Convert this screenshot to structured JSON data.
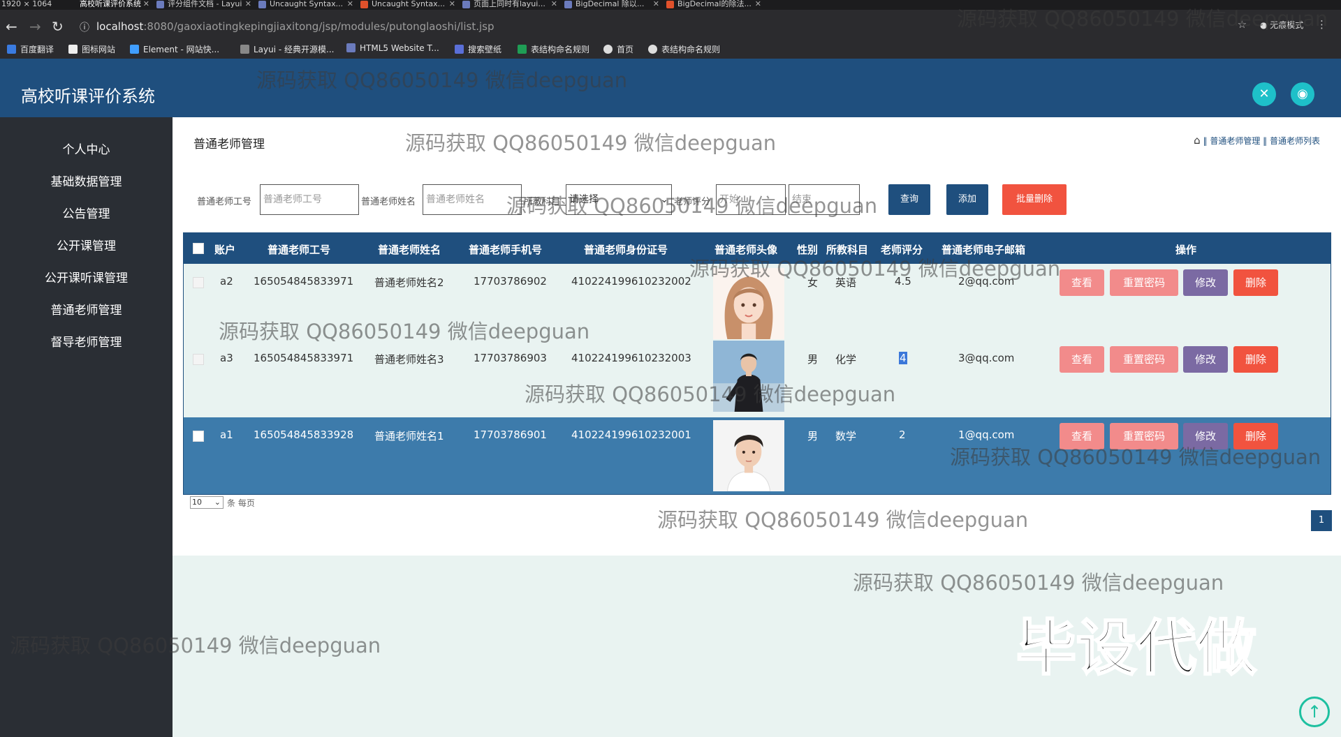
{
  "browser": {
    "tabs": [
      {
        "label": "1920 × 1064"
      },
      {
        "label": "高校听课评价系统"
      },
      {
        "label": "评分组件文档 - Layui"
      },
      {
        "label": "Uncaught Syntax..."
      },
      {
        "label": "Uncaught Syntax..."
      },
      {
        "label": "页面上同时有layui..."
      },
      {
        "label": "BigDecimal 除以..."
      },
      {
        "label": "BigDecimal的除法..."
      }
    ],
    "url_host": "localhost",
    "url_path": ":8080/gaoxiaotingkepingjiaxitong/jsp/modules/putonglaoshi/list.jsp",
    "incognito": "无痕模式",
    "bookmarks": [
      "百度翻译",
      "图标网站",
      "Element - 网站快...",
      "Layui - 经典开源模...",
      "HTML5 Website T...",
      "搜索壁纸",
      "表结构命名规则",
      "首页",
      "表结构命名规则"
    ]
  },
  "app": {
    "title": "高校听课评价系统",
    "menu": [
      "个人中心",
      "基础数据管理",
      "公告管理",
      "公开课管理",
      "公开课听课管理",
      "普通老师管理",
      "督导老师管理"
    ]
  },
  "page": {
    "heading": "普通老师管理",
    "breadcrumb": {
      "sep": "‖",
      "level1": "普通老师管理",
      "level2": "普通老师列表"
    }
  },
  "filters": {
    "label_id": "普通老师工号",
    "placeholder_id": "普通老师工号",
    "label_name": "普通老师姓名",
    "placeholder_name": "普通老师姓名",
    "label_subject": "所教科目",
    "subject_value": "请选择",
    "label_score": "老师评分",
    "placeholder_score_min": "开始",
    "placeholder_score_max": "结束",
    "btn_query": "查询",
    "btn_add": "添加",
    "btn_batch_delete": "批量删除"
  },
  "table": {
    "headers": [
      "账户",
      "普通老师工号",
      "普通老师姓名",
      "普通老师手机号",
      "普通老师身份证号",
      "普通老师头像",
      "性别",
      "所教科目",
      "老师评分",
      "普通老师电子邮箱",
      "操作"
    ],
    "rows": [
      {
        "account": "a2",
        "id": "165054845833971",
        "name": "普通老师姓名2",
        "phone": "17703786902",
        "idcard": "410224199610232002",
        "gender": "女",
        "subject": "英语",
        "score": "4.5",
        "email": "2@qq.com"
      },
      {
        "account": "a3",
        "id": "165054845833971",
        "name": "普通老师姓名3",
        "phone": "17703786903",
        "idcard": "410224199610232003",
        "gender": "男",
        "subject": "化学",
        "score": "4",
        "email": "3@qq.com"
      },
      {
        "account": "a1",
        "id": "165054845833928",
        "name": "普通老师姓名1",
        "phone": "17703786901",
        "idcard": "410224199610232001",
        "gender": "男",
        "subject": "数学",
        "score": "2",
        "email": "1@qq.com"
      }
    ],
    "actions": {
      "view": "查看",
      "reset": "重置密码",
      "edit": "修改",
      "delete": "删除"
    }
  },
  "pager": {
    "page_size": "10",
    "per_page_text": "条 每页",
    "current_page": "1"
  },
  "overlay": {
    "watermark": "源码获取 QQ86050149 微信deepguan",
    "big_text": "毕设代做"
  }
}
